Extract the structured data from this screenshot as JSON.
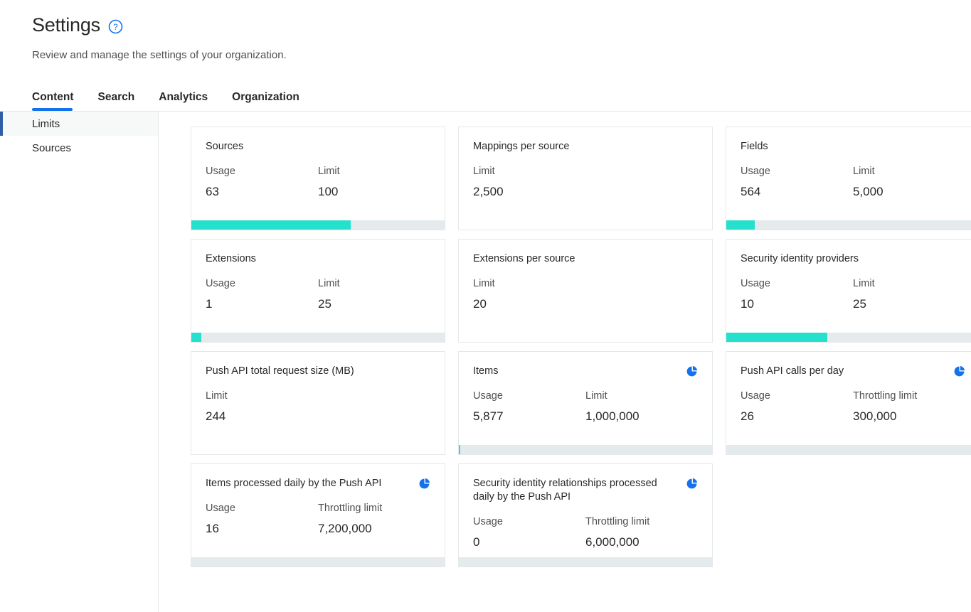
{
  "header": {
    "title": "Settings",
    "help_icon": "help-circle-icon",
    "subtitle": "Review and manage the settings of your organization."
  },
  "tabs": [
    {
      "label": "Content",
      "active": true
    },
    {
      "label": "Search",
      "active": false
    },
    {
      "label": "Analytics",
      "active": false
    },
    {
      "label": "Organization",
      "active": false
    }
  ],
  "sidebar": {
    "items": [
      {
        "label": "Limits",
        "active": true
      },
      {
        "label": "Sources",
        "active": false
      }
    ]
  },
  "colors": {
    "accent_blue": "#1372ec",
    "sidebar_active_bar": "#2f5ea8",
    "progress_fill": "#25e0cd",
    "progress_track": "#e5eaed"
  },
  "cards": [
    {
      "title": "Sources",
      "icon": null,
      "usage_label": "Usage",
      "usage_value": "63",
      "limit_label": "Limit",
      "limit_value": "100",
      "has_bar": true,
      "percent": 63
    },
    {
      "title": "Mappings per source",
      "icon": null,
      "usage_label": null,
      "usage_value": null,
      "limit_label": "Limit",
      "limit_value": "2,500",
      "has_bar": false,
      "percent": 0
    },
    {
      "title": "Fields",
      "icon": null,
      "usage_label": "Usage",
      "usage_value": "564",
      "limit_label": "Limit",
      "limit_value": "5,000",
      "has_bar": true,
      "percent": 11.3
    },
    {
      "title": "Extensions",
      "icon": null,
      "usage_label": "Usage",
      "usage_value": "1",
      "limit_label": "Limit",
      "limit_value": "25",
      "has_bar": true,
      "percent": 4
    },
    {
      "title": "Extensions per source",
      "icon": null,
      "usage_label": null,
      "usage_value": null,
      "limit_label": "Limit",
      "limit_value": "20",
      "has_bar": false,
      "percent": 0
    },
    {
      "title": "Security identity providers",
      "icon": null,
      "usage_label": "Usage",
      "usage_value": "10",
      "limit_label": "Limit",
      "limit_value": "25",
      "has_bar": true,
      "percent": 40
    },
    {
      "title": "Push API total request size (MB)",
      "icon": null,
      "usage_label": null,
      "usage_value": null,
      "limit_label": "Limit",
      "limit_value": "244",
      "has_bar": false,
      "percent": 0
    },
    {
      "title": "Items",
      "icon": "pie-chart-icon",
      "usage_label": "Usage",
      "usage_value": "5,877",
      "limit_label": "Limit",
      "limit_value": "1,000,000",
      "has_bar": true,
      "percent": 0.6
    },
    {
      "title": "Push API calls per day",
      "icon": "pie-chart-icon",
      "usage_label": "Usage",
      "usage_value": "26",
      "limit_label": "Throttling limit",
      "limit_value": "300,000",
      "has_bar": true,
      "percent": 0.01
    },
    {
      "title": "Items processed daily by the Push API",
      "icon": "pie-chart-icon",
      "usage_label": "Usage",
      "usage_value": "16",
      "limit_label": "Throttling limit",
      "limit_value": "7,200,000",
      "has_bar": true,
      "percent": 0.01
    },
    {
      "title": "Security identity relationships processed daily by the Push API",
      "icon": "pie-chart-icon",
      "usage_label": "Usage",
      "usage_value": "0",
      "limit_label": "Throttling limit",
      "limit_value": "6,000,000",
      "has_bar": true,
      "percent": 0
    }
  ]
}
